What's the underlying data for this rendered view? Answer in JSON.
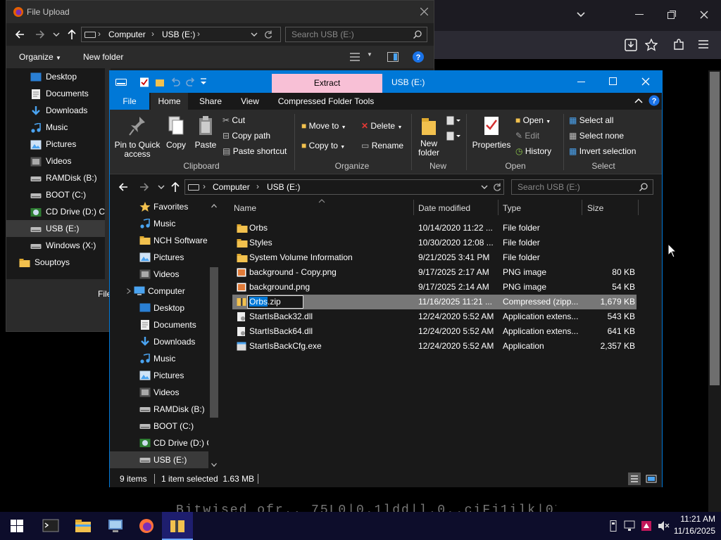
{
  "colors": {
    "accent": "#0078d7",
    "extract_tab": "#f8c0d6",
    "folder": "#f2c14e",
    "taskbar": "#0d0d2b"
  },
  "upload_dialog": {
    "title": "File Upload",
    "path": [
      "Computer",
      "USB (E:)"
    ],
    "search_placeholder": "Search USB (E:)",
    "organize": "Organize",
    "new_folder": "New folder",
    "sidebar": [
      "Desktop",
      "Documents",
      "Downloads",
      "Music",
      "Pictures",
      "Videos",
      "RAMDisk (B:)",
      "BOOT (C:)",
      "CD Drive (D:) C",
      "USB (E:)",
      "Windows (X:)",
      "Souptoys"
    ],
    "bottom_label": "File"
  },
  "explorer": {
    "title": "USB (E:)",
    "extract_tab": "Extract",
    "tabs": [
      "File",
      "Home",
      "Share",
      "View",
      "Compressed Folder Tools"
    ],
    "clipboard": {
      "pin": "Pin to Quick access",
      "copy": "Copy",
      "paste": "Paste",
      "cut": "Cut",
      "copy_path": "Copy path",
      "paste_shortcut": "Paste shortcut",
      "label": "Clipboard"
    },
    "organize": {
      "move_to": "Move to",
      "copy_to": "Copy to",
      "delete": "Delete",
      "rename": "Rename",
      "label": "Organize"
    },
    "new": {
      "new_folder": "New folder",
      "label": "New"
    },
    "open": {
      "properties": "Properties",
      "open": "Open",
      "edit": "Edit",
      "history": "History",
      "label": "Open"
    },
    "select": {
      "select_all": "Select all",
      "select_none": "Select none",
      "invert": "Invert selection",
      "label": "Select"
    },
    "address": [
      "Computer",
      "USB (E:)"
    ],
    "search_placeholder": "Search USB (E:)",
    "nav": [
      {
        "label": "Favorites",
        "icon": "star-icon"
      },
      {
        "label": "Music",
        "icon": "music-icon"
      },
      {
        "label": "NCH Software",
        "icon": "folder-icon"
      },
      {
        "label": "Pictures",
        "icon": "pictures-icon"
      },
      {
        "label": "Videos",
        "icon": "videos-icon"
      },
      {
        "label": "Computer",
        "icon": "computer-icon"
      },
      {
        "label": "Desktop",
        "icon": "desktop-icon"
      },
      {
        "label": "Documents",
        "icon": "documents-icon"
      },
      {
        "label": "Downloads",
        "icon": "downloads-icon"
      },
      {
        "label": "Music",
        "icon": "music-icon"
      },
      {
        "label": "Pictures",
        "icon": "pictures-icon"
      },
      {
        "label": "Videos",
        "icon": "videos-icon"
      },
      {
        "label": "RAMDisk (B:)",
        "icon": "drive-icon"
      },
      {
        "label": "BOOT (C:)",
        "icon": "drive-icon"
      },
      {
        "label": "CD Drive (D:) C",
        "icon": "cd-icon"
      },
      {
        "label": "USB (E:)",
        "icon": "usb-drive-icon"
      }
    ],
    "columns": [
      "Name",
      "Date modified",
      "Type",
      "Size"
    ],
    "files": [
      {
        "name": "Orbs",
        "date": "10/14/2020 11:22 ...",
        "type": "File folder",
        "size": "",
        "icon": "folder-icon"
      },
      {
        "name": "Styles",
        "date": "10/30/2020 12:08 ...",
        "type": "File folder",
        "size": "",
        "icon": "folder-icon"
      },
      {
        "name": "System Volume Information",
        "date": "9/21/2025 3:41 PM",
        "type": "File folder",
        "size": "",
        "icon": "folder-icon"
      },
      {
        "name": "background - Copy.png",
        "date": "9/17/2025 2:17 AM",
        "type": "PNG image",
        "size": "80 KB",
        "icon": "image-icon"
      },
      {
        "name": "background.png",
        "date": "9/17/2025 2:14 AM",
        "type": "PNG image",
        "size": "54 KB",
        "icon": "image-icon"
      },
      {
        "name": "Orbs.zip",
        "date": "11/16/2025 11:21 ...",
        "type": "Compressed (zipp...",
        "size": "1,679 KB",
        "icon": "zip-icon",
        "selected": true,
        "rename_value": "Orbs.zip"
      },
      {
        "name": "StartIsBack32.dll",
        "date": "12/24/2020 5:52 AM",
        "type": "Application extens...",
        "size": "543 KB",
        "icon": "dll-icon"
      },
      {
        "name": "StartIsBack64.dll",
        "date": "12/24/2020 5:52 AM",
        "type": "Application extens...",
        "size": "641 KB",
        "icon": "dll-icon"
      },
      {
        "name": "StartIsBackCfg.exe",
        "date": "12/24/2020 5:52 AM",
        "type": "Application",
        "size": "2,357 KB",
        "icon": "exe-icon"
      }
    ],
    "status": {
      "items": "9 items",
      "selected": "1 item selected  1.63 MB"
    }
  },
  "background_text": "Bitwised ofr.. 75L0|0.1ldd|l.0..ciFj1ilk|07",
  "taskbar": {
    "time": "11:21 AM",
    "date": "11/16/2025"
  }
}
